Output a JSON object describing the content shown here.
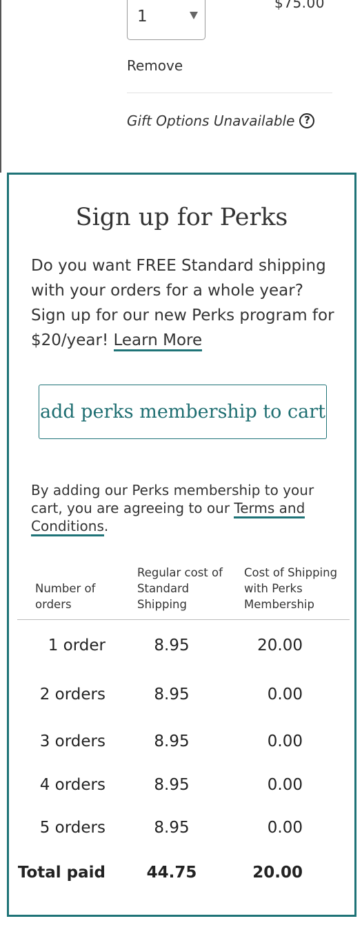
{
  "cart_item": {
    "quantity": "1",
    "price": "$75.00",
    "remove_label": "Remove",
    "gift_options": "Gift Options Unavailable",
    "help_glyph": "?"
  },
  "perks": {
    "title": "Sign up for Perks",
    "description": "Do you want FREE Standard shipping with your orders for a whole year? Sign up for our new Perks program for $20/year!",
    "learn_more": "Learn More",
    "add_button": "add perks membership to cart",
    "agreement_prefix": "By adding our Perks membership to your cart, you are agreeing to our",
    "terms_link": "Terms and Conditions",
    "agreement_suffix": ".",
    "accent_color": "#1e7377"
  },
  "shipping_table": {
    "headers": [
      "Number of orders",
      "Regular cost of Standard Shipping",
      "Cost of Shipping with Perks Membership"
    ],
    "rows": [
      {
        "orders": "1 order",
        "regular": "8.95",
        "perks": "20.00"
      },
      {
        "orders": "2 orders",
        "regular": "8.95",
        "perks": "0.00"
      },
      {
        "orders": "3 orders",
        "regular": "8.95",
        "perks": "0.00"
      },
      {
        "orders": "4 orders",
        "regular": "8.95",
        "perks": "0.00"
      },
      {
        "orders": "5 orders",
        "regular": "8.95",
        "perks": "0.00"
      }
    ],
    "total": {
      "label": "Total paid",
      "regular": "44.75",
      "perks": "20.00"
    }
  },
  "icons": {
    "quantity_dropdown": "chevron-down-icon",
    "gift_help": "question-circle-icon"
  }
}
